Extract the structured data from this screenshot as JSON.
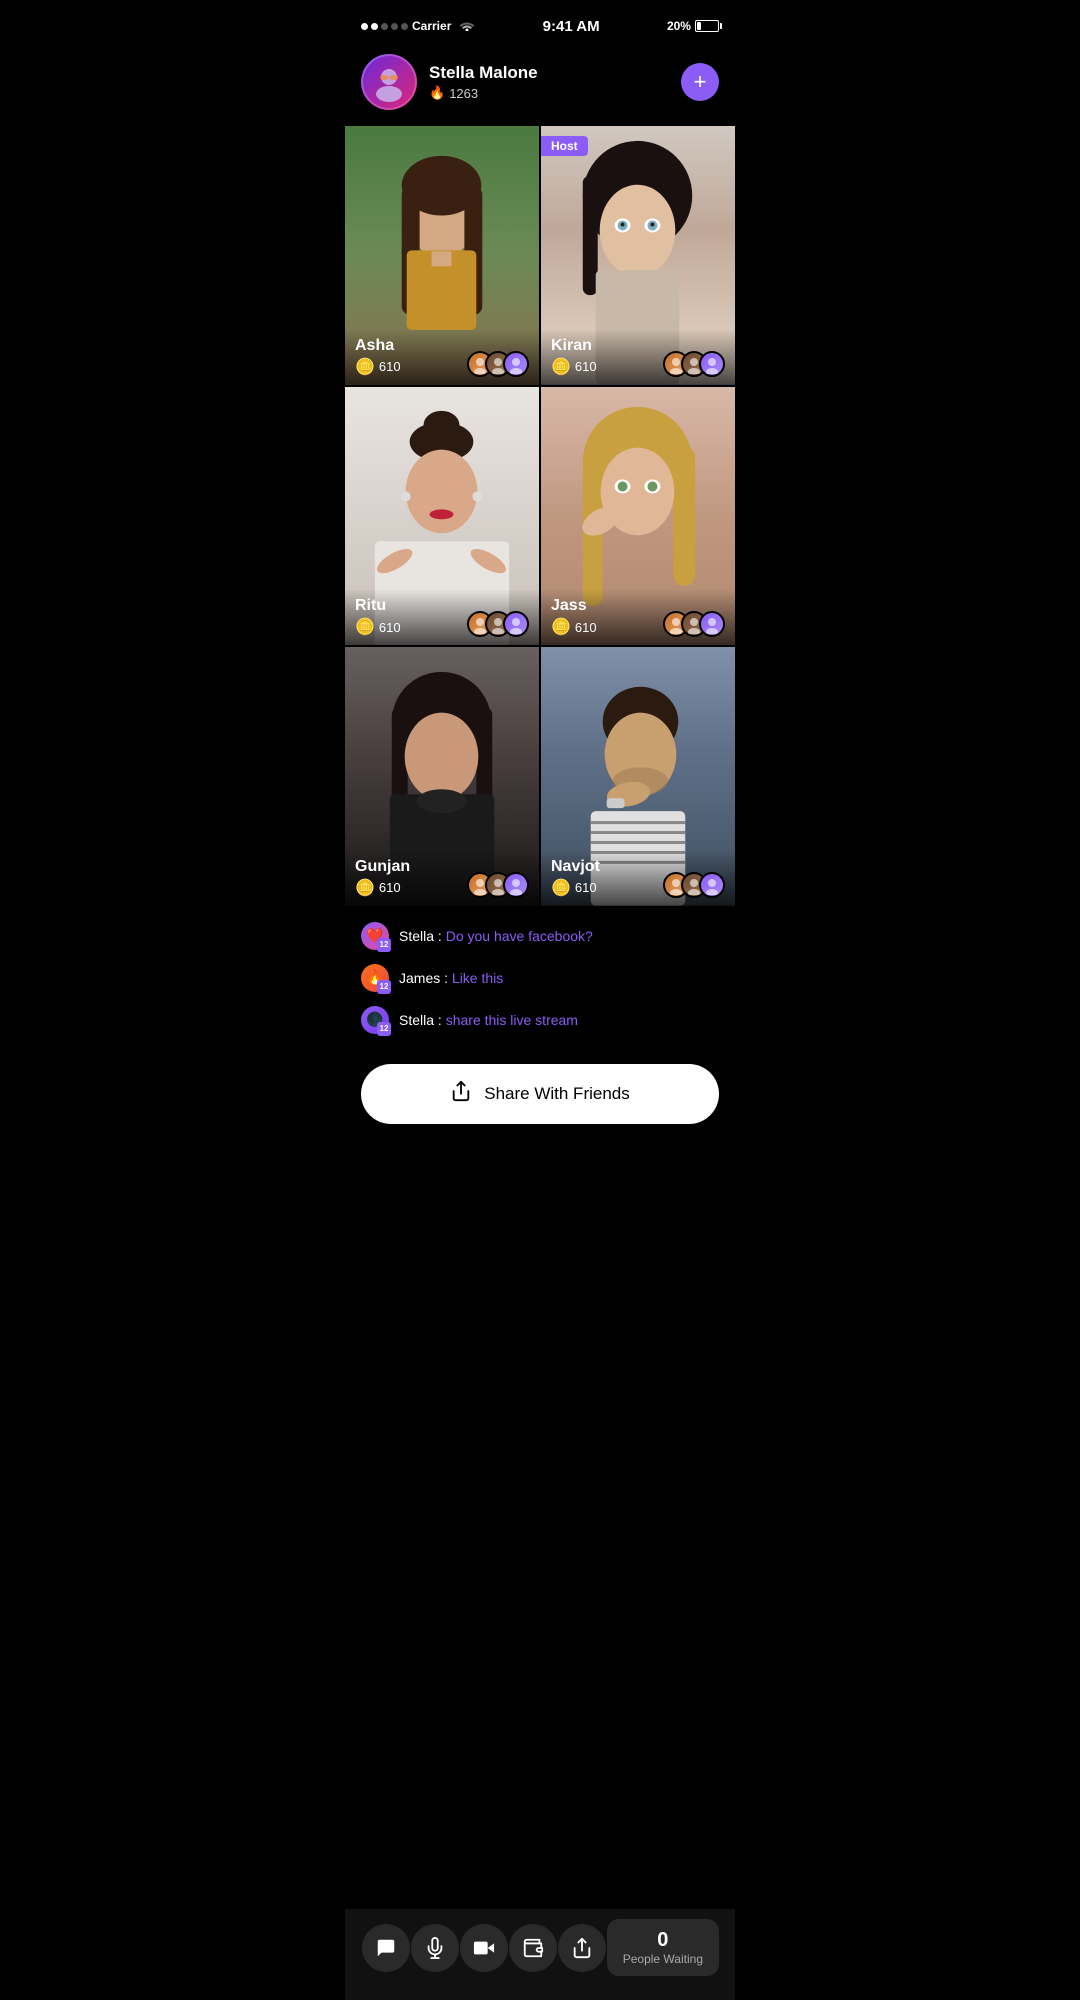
{
  "status": {
    "carrier": "Carrier",
    "time": "9:41 AM",
    "battery": "20%",
    "signal_dots": [
      true,
      true,
      false,
      false,
      false
    ]
  },
  "profile": {
    "name": "Stella Malone",
    "score": "1263",
    "add_button_label": "+",
    "fire_icon": "🔥"
  },
  "host_badge": "Host",
  "video_cells": [
    {
      "id": "asha",
      "name": "Asha",
      "coins": "610",
      "is_host": false
    },
    {
      "id": "kiran",
      "name": "Kiran",
      "coins": "610",
      "is_host": true
    },
    {
      "id": "ritu",
      "name": "Ritu",
      "coins": "610",
      "is_host": false
    },
    {
      "id": "jass",
      "name": "Jass",
      "coins": "610",
      "is_host": false
    },
    {
      "id": "gunjan",
      "name": "Gunjan",
      "coins": "610",
      "is_host": false
    },
    {
      "id": "navjot",
      "name": "Navjot",
      "coins": "610",
      "is_host": false
    }
  ],
  "chat": {
    "messages": [
      {
        "user": "Stella",
        "content": "Do you have facebook?",
        "badge_type": "heart",
        "level": "12"
      },
      {
        "user": "James",
        "content": "Like this",
        "badge_type": "fire",
        "level": "12"
      },
      {
        "user": "Stella",
        "content": "share this live stream",
        "badge_type": "fire2",
        "level": "12"
      }
    ]
  },
  "share_button": {
    "label": "Share With Friends"
  },
  "bottom_bar": {
    "icons": [
      "chat",
      "mic",
      "video",
      "wallet",
      "share"
    ],
    "people_waiting": {
      "count": "0",
      "label": "People Waiting"
    }
  },
  "coin_emoji": "🪙"
}
